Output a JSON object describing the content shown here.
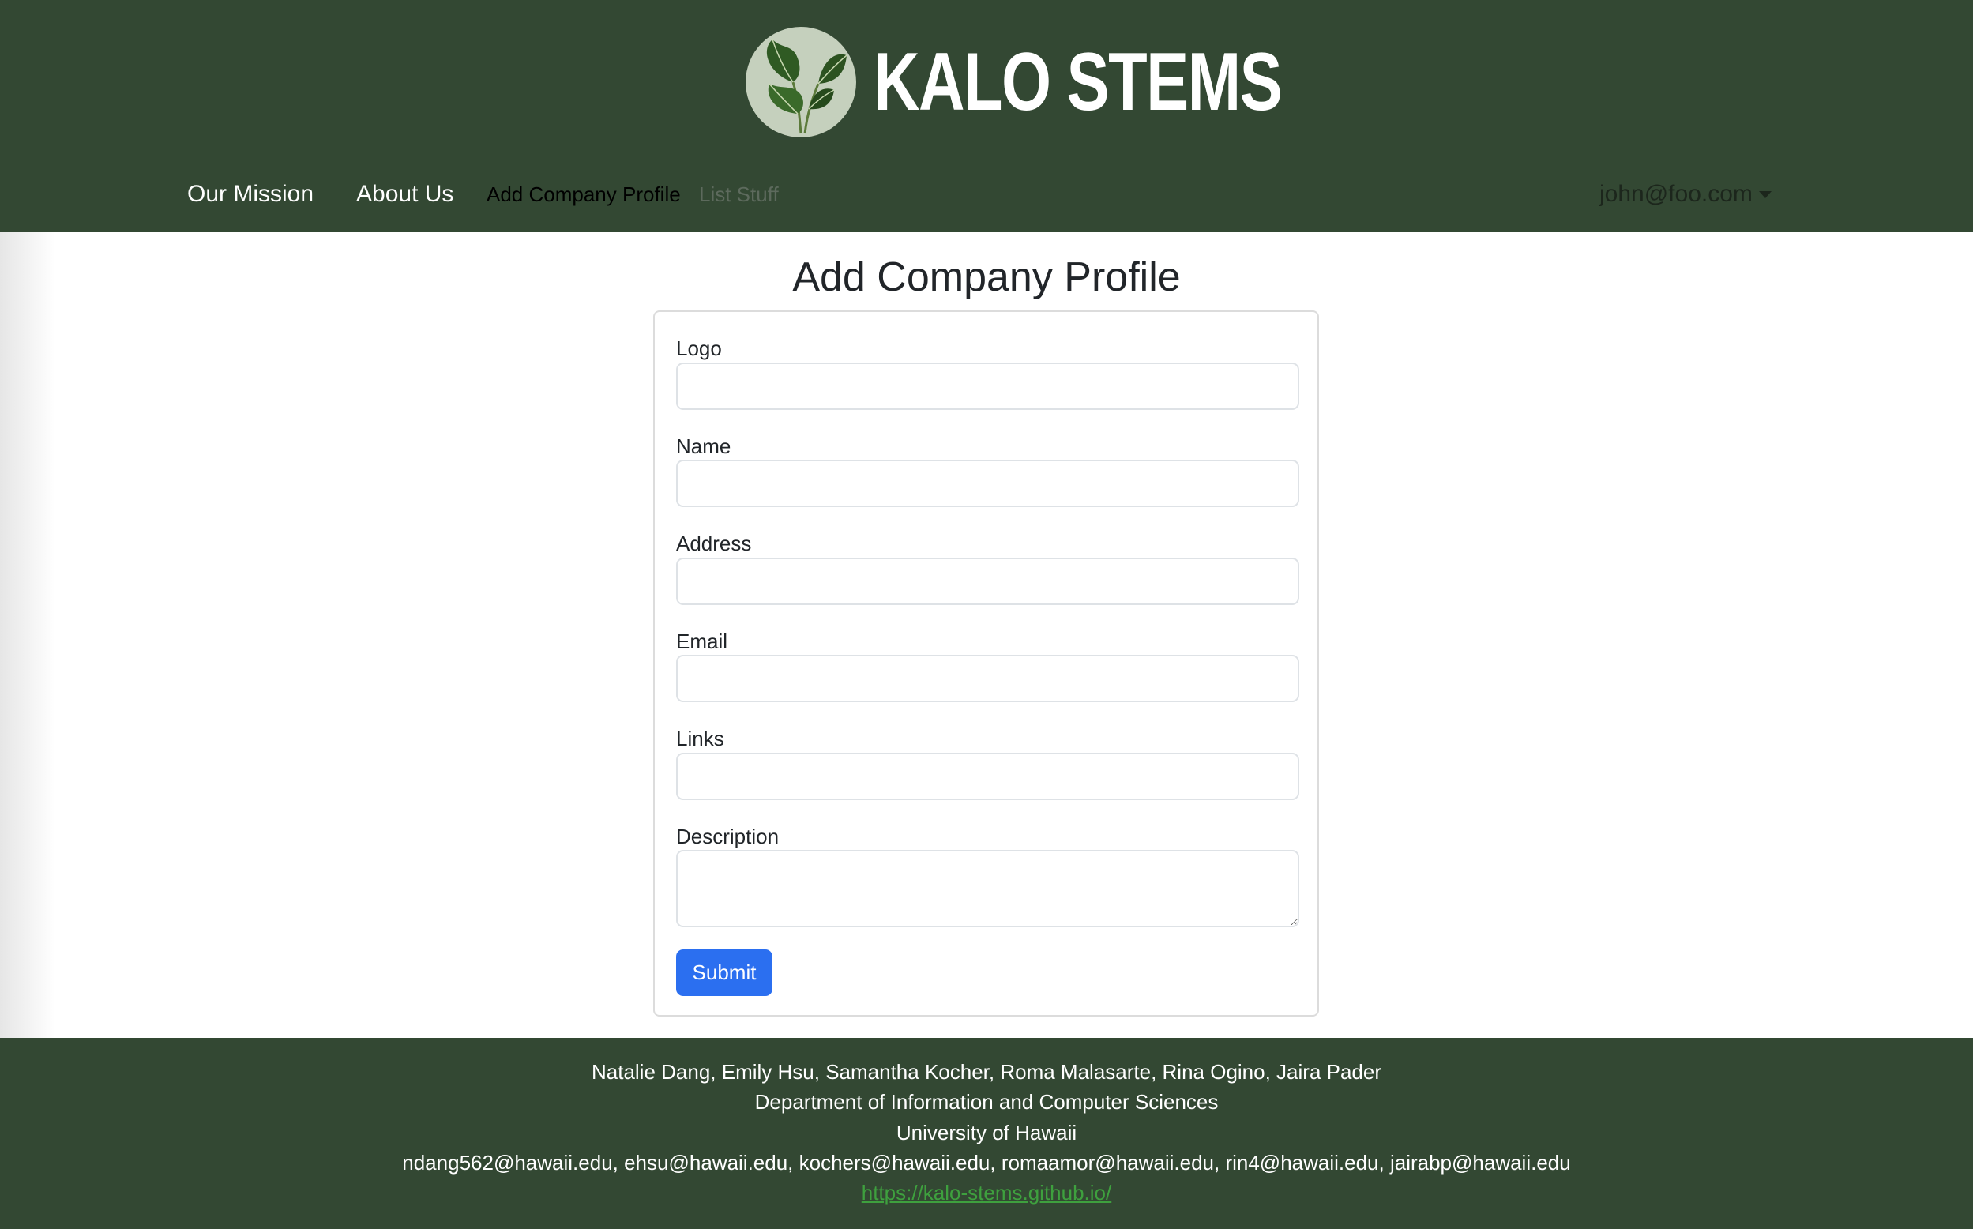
{
  "header": {
    "brand_title": "KALO STEMS",
    "logo_icon": "taro-leaf-logo-icon",
    "nav": {
      "our_mission": "Our Mission",
      "about_us": "About Us",
      "add_company_profile": "Add Company Profile",
      "list_stuff": "List Stuff"
    },
    "user_menu": "john@foo.com"
  },
  "main": {
    "title": "Add Company Profile",
    "form": {
      "fields": [
        {
          "label": "Logo",
          "value": ""
        },
        {
          "label": "Name",
          "value": ""
        },
        {
          "label": "Address",
          "value": ""
        },
        {
          "label": "Email",
          "value": ""
        },
        {
          "label": "Links",
          "value": ""
        },
        {
          "label": "Description",
          "value": ""
        }
      ],
      "submit_label": "Submit"
    }
  },
  "footer": {
    "names": "Natalie Dang, Emily Hsu, Samantha Kocher, Roma Malasarte, Rina Ogino, Jaira Pader",
    "department": "Department of Information and Computer Sciences",
    "university": "University of Hawaii",
    "emails": "ndang562@hawaii.edu, ehsu@hawaii.edu, kochers@hawaii.edu, romaamor@hawaii.edu, rin4@hawaii.edu, jairabp@hawaii.edu",
    "link": "https://kalo-stems.github.io/"
  },
  "colors": {
    "header_bg": "#334833",
    "footer_bg": "#334833",
    "button_primary": "#2b6ff0",
    "footer_link": "#3ea03e"
  }
}
